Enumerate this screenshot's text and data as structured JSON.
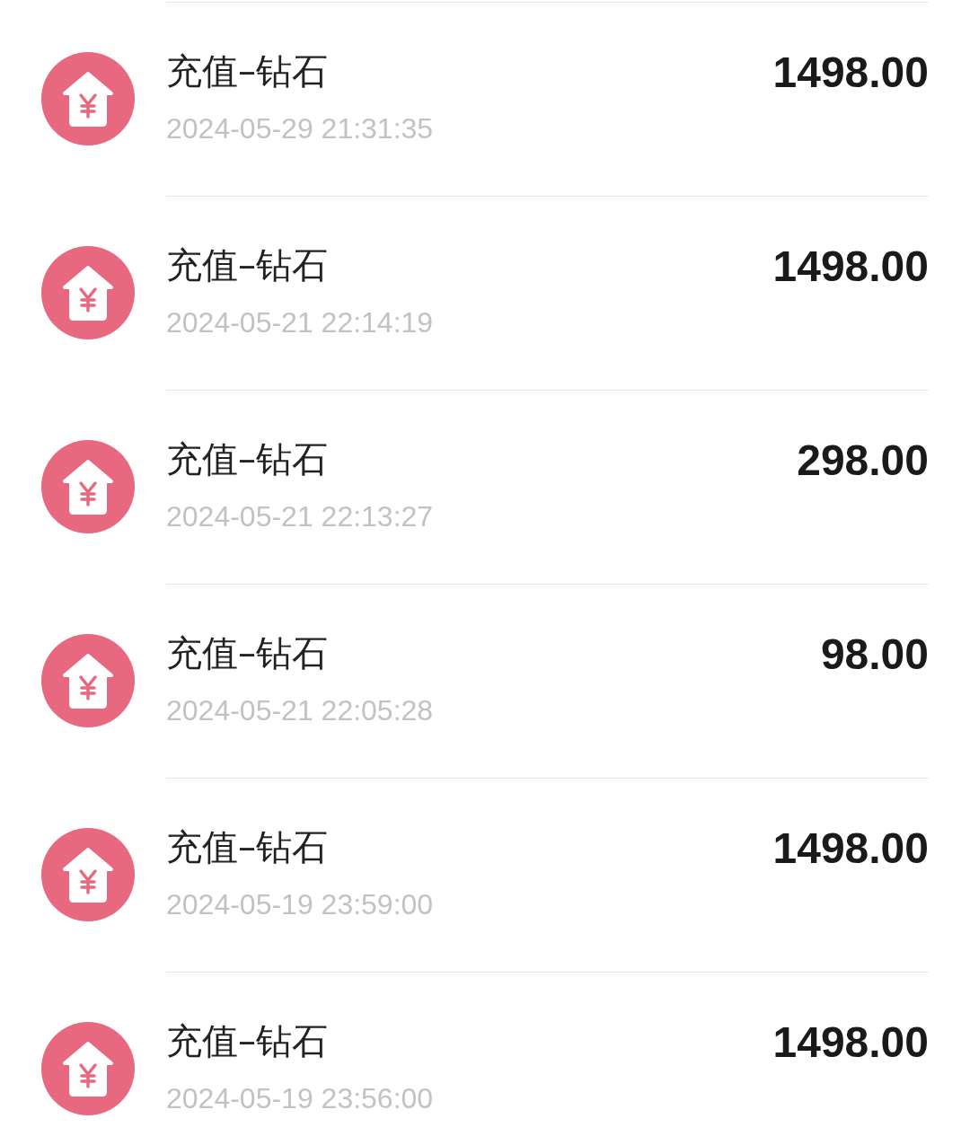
{
  "transactions": [
    {
      "title": "充值–钻石",
      "time": "2024-05-29 21:31:35",
      "amount": "1498.00"
    },
    {
      "title": "充值–钻石",
      "time": "2024-05-21 22:14:19",
      "amount": "1498.00"
    },
    {
      "title": "充值–钻石",
      "time": "2024-05-21 22:13:27",
      "amount": "298.00"
    },
    {
      "title": "充值–钻石",
      "time": "2024-05-21 22:05:28",
      "amount": "98.00"
    },
    {
      "title": "充值–钻石",
      "time": "2024-05-19 23:59:00",
      "amount": "1498.00"
    },
    {
      "title": "充值–钻石",
      "time": "2024-05-19 23:56:00",
      "amount": "1498.00"
    }
  ]
}
